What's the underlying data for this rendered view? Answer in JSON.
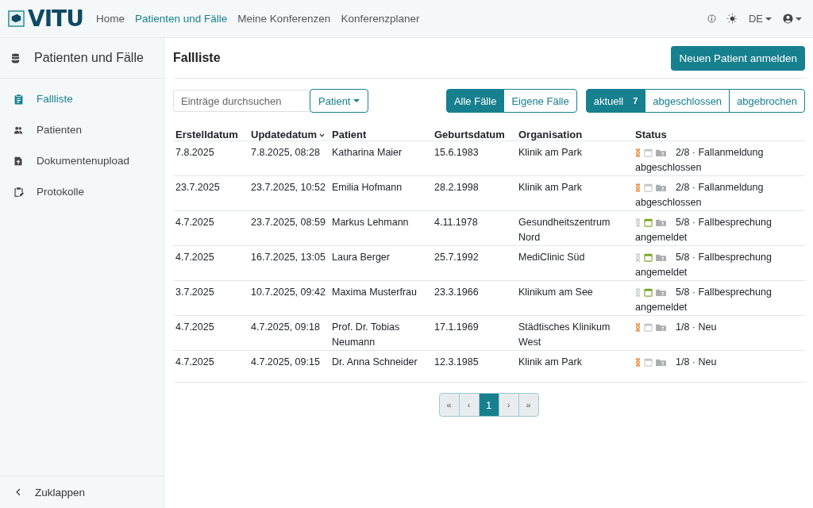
{
  "topbar": {
    "logo": "VITU",
    "nav": [
      {
        "label": "Home",
        "selected": false
      },
      {
        "label": "Patienten und Fälle",
        "selected": true
      },
      {
        "label": "Meine Konferenzen",
        "selected": false
      },
      {
        "label": "Konferenzplaner",
        "selected": false
      }
    ],
    "language": "DE"
  },
  "sidebar": {
    "title": "Patienten und Fälle",
    "items": [
      {
        "label": "Fallliste",
        "kind": "clipboard",
        "selected": true
      },
      {
        "label": "Patienten",
        "kind": "people",
        "selected": false
      },
      {
        "label": "Dokumentenupload",
        "kind": "upload",
        "selected": false
      },
      {
        "label": "Protokolle",
        "kind": "protocol",
        "selected": false
      }
    ],
    "collapse": "Zuklappen"
  },
  "page": {
    "title": "Fallliste",
    "new_button": "Neuen Patient anmelden",
    "search": {
      "placeholder": "Einträge durchsuchen"
    },
    "search_scope": "Patient",
    "scope_filters": [
      {
        "label": "Alle Fälle",
        "selected": true
      },
      {
        "label": "Eigene Fälle",
        "selected": false
      }
    ],
    "status_filters": [
      {
        "label": "aktuell",
        "count": "7",
        "selected": true
      },
      {
        "label": "abgeschlossen",
        "selected": false
      },
      {
        "label": "abgebrochen",
        "selected": false
      }
    ]
  },
  "table": {
    "columns": [
      {
        "label": "Erstelldatum",
        "sorted": false
      },
      {
        "label": "Updatedatum",
        "sorted": true
      },
      {
        "label": "Patient",
        "sorted": false
      },
      {
        "label": "Geburtsdatum",
        "sorted": false
      },
      {
        "label": "Organisation",
        "sorted": false
      },
      {
        "label": "Status",
        "sorted": false
      }
    ],
    "rows": [
      {
        "cells": [
          "7.8.2025",
          "7.8.2025, 08:28",
          "Katharina Maier",
          "15.6.1983",
          "Klinik am Park"
        ],
        "status": {
          "steps": [
            {
              "kind": "hourglass",
              "active": true
            },
            {
              "kind": "calendar",
              "active": false
            },
            {
              "kind": "folder",
              "active": false
            }
          ],
          "text": "2/8 · Fallanmeldung abgeschlossen"
        }
      },
      {
        "cells": [
          "23.7.2025",
          "23.7.2025, 10:52",
          "Emilia Hofmann",
          "28.2.1998",
          "Klinik am Park"
        ],
        "status": {
          "steps": [
            {
              "kind": "hourglass",
              "active": true
            },
            {
              "kind": "calendar",
              "active": false
            },
            {
              "kind": "folder",
              "active": false
            }
          ],
          "text": "2/8 · Fallanmeldung abgeschlossen"
        }
      },
      {
        "cells": [
          "4.7.2025",
          "23.7.2025, 08:59",
          "Markus Lehmann",
          "4.11.1978",
          "Gesundheitszentrum Nord"
        ],
        "status": {
          "steps": [
            {
              "kind": "hourglass",
              "active": false
            },
            {
              "kind": "calendar",
              "active": true
            },
            {
              "kind": "folder",
              "active": false
            }
          ],
          "text": "5/8 · Fallbesprechung angemeldet"
        }
      },
      {
        "cells": [
          "4.7.2025",
          "16.7.2025, 13:05",
          "Laura Berger",
          "25.7.1992",
          "MediClinic Süd"
        ],
        "status": {
          "steps": [
            {
              "kind": "hourglass",
              "active": false
            },
            {
              "kind": "calendar",
              "active": true
            },
            {
              "kind": "folder",
              "active": false
            }
          ],
          "text": "5/8 · Fallbesprechung angemeldet"
        }
      },
      {
        "cells": [
          "3.7.2025",
          "10.7.2025, 09:42",
          "Maxima Musterfrau",
          "23.3.1966",
          "Klinikum am See"
        ],
        "status": {
          "steps": [
            {
              "kind": "hourglass",
              "active": false
            },
            {
              "kind": "calendar",
              "active": true
            },
            {
              "kind": "folder",
              "active": false
            }
          ],
          "text": "5/8 · Fallbesprechung angemeldet"
        }
      },
      {
        "cells": [
          "4.7.2025",
          "4.7.2025, 09:18",
          "Prof. Dr. Tobias Neumann",
          "17.1.1969",
          "Städtisches Klinikum West"
        ],
        "status": {
          "steps": [
            {
              "kind": "hourglass",
              "active": true
            },
            {
              "kind": "calendar",
              "active": false
            },
            {
              "kind": "folder",
              "active": false
            }
          ],
          "text": "1/8 · Neu"
        }
      },
      {
        "cells": [
          "4.7.2025",
          "4.7.2025, 09:15",
          "Dr. Anna Schneider",
          "12.3.1985",
          "Klinik am Park"
        ],
        "status": {
          "steps": [
            {
              "kind": "hourglass",
              "active": true
            },
            {
              "kind": "calendar",
              "active": false
            },
            {
              "kind": "folder",
              "active": false
            }
          ],
          "text": "1/8 · Neu"
        }
      }
    ]
  },
  "pagination": [
    {
      "label": "«",
      "selected": false,
      "disabled": true
    },
    {
      "label": "‹",
      "selected": false,
      "disabled": true
    },
    {
      "label": "1",
      "selected": true,
      "disabled": false
    },
    {
      "label": "›",
      "selected": false,
      "disabled": true
    },
    {
      "label": "»",
      "selected": false,
      "disabled": true
    }
  ]
}
